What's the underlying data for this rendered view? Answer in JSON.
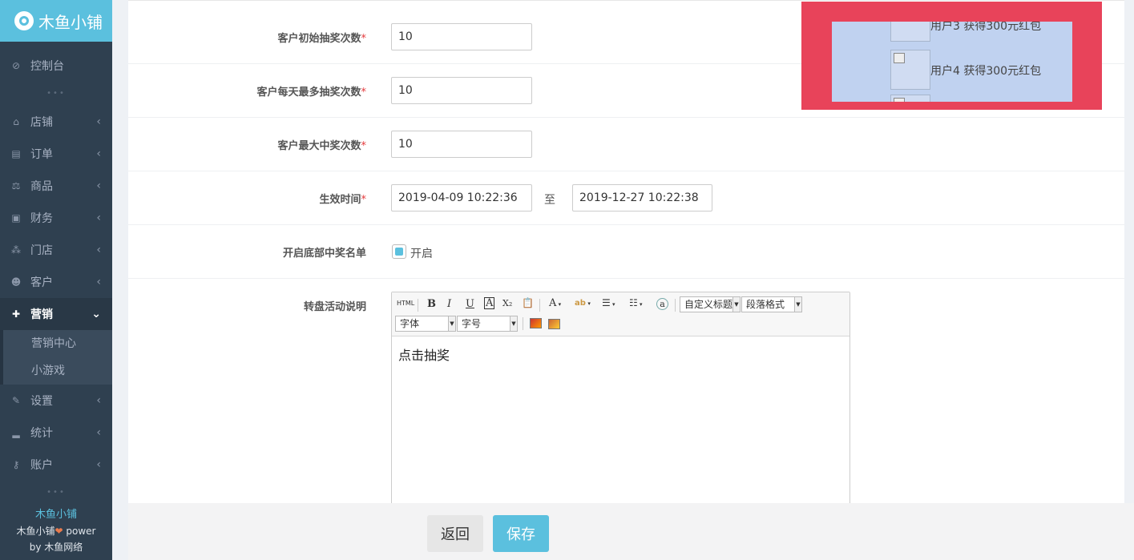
{
  "sidebar": {
    "logo_text": "木鱼小铺",
    "items": [
      {
        "label": "控制台",
        "icon": "dashboard-icon",
        "glyph": "⊘"
      },
      {
        "label": "店铺",
        "icon": "shop-basket-icon",
        "glyph": "⌂"
      },
      {
        "label": "订单",
        "icon": "orders-icon",
        "glyph": "▤"
      },
      {
        "label": "商品",
        "icon": "scale-icon",
        "glyph": "⚖"
      },
      {
        "label": "财务",
        "icon": "money-icon",
        "glyph": "▣"
      },
      {
        "label": "门店",
        "icon": "sitemap-icon",
        "glyph": "⁂"
      },
      {
        "label": "客户",
        "icon": "users-icon",
        "glyph": "☻"
      },
      {
        "label": "营销",
        "icon": "gift-icon",
        "glyph": "✚"
      },
      {
        "label": "设置",
        "icon": "wrench-icon",
        "glyph": "✎"
      },
      {
        "label": "统计",
        "icon": "signal-icon",
        "glyph": "▂"
      },
      {
        "label": "账户",
        "icon": "key-icon",
        "glyph": "⚷"
      }
    ],
    "subitems": [
      "营销中心",
      "小游戏"
    ],
    "footer": {
      "brand": "木鱼小铺",
      "line2_a": "木鱼小铺",
      "heart": "❤",
      "line2_b": " power",
      "line3": "by 木鱼网络"
    }
  },
  "form": {
    "initial_draws": {
      "label": "客户初始抽奖次数",
      "req": "*",
      "value": "10"
    },
    "daily_max_draws": {
      "label": "客户每天最多抽奖次数",
      "req": "*",
      "value": "10"
    },
    "max_wins": {
      "label": "客户最大中奖次数",
      "req": "*",
      "value": "10"
    },
    "effective_time": {
      "label": "生效时间",
      "req": "*",
      "start": "2019-04-09 10:22:36",
      "separator": "至",
      "end": "2019-12-27 10:22:38"
    },
    "bottom_winner_list": {
      "label": "开启底部中奖名单",
      "option": "开启",
      "checked": true
    },
    "description": {
      "label": "转盘活动说明",
      "content": "点击抽奖"
    }
  },
  "editor_toolbar": {
    "html": "HTML",
    "bold": "B",
    "italic": "I",
    "underline": "U",
    "font_color": "A",
    "subscript": "X₂",
    "text_color": "A",
    "highlight": "ab",
    "custom_title": "自定义标题",
    "paragraph_format": "段落格式",
    "font_family": "字体",
    "font_size": "字号"
  },
  "winners": [
    {
      "text": "用户3 获得300元红包"
    },
    {
      "text": "用户4 获得300元红包"
    }
  ],
  "actions": {
    "back": "返回",
    "save": "保存"
  },
  "colors": {
    "accent": "#5bc0de",
    "sidebar_bg": "#2f4050",
    "overlay": "#e8435a",
    "overlay_inner": "#c0d2f0",
    "required": "#e4393c"
  }
}
